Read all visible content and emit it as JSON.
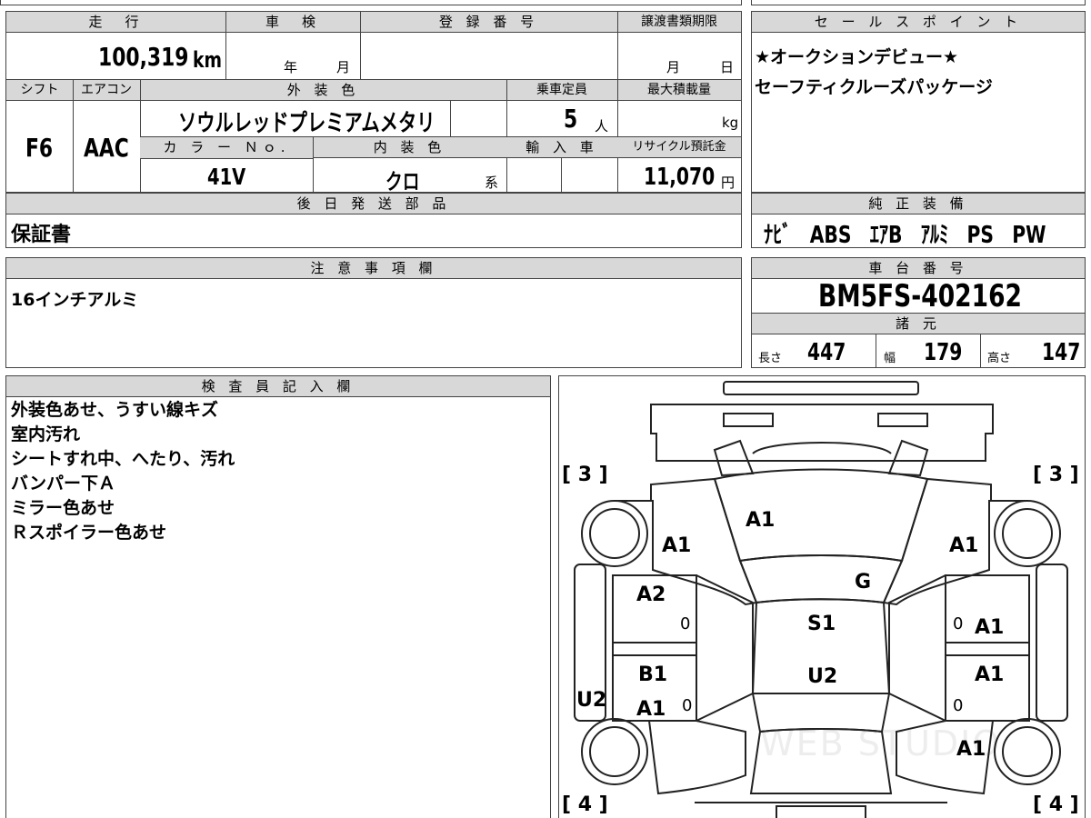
{
  "vehicle": {
    "mileage_header": "走　行",
    "mileage_value": "100,319",
    "mileage_unit": "km",
    "inspection_header": "車　検",
    "inspection_year": "年",
    "inspection_month": "月",
    "registration_header": "登 録 番 号",
    "transfer_header": "譲渡書類期限",
    "transfer_month": "月",
    "transfer_day": "日",
    "shift_header": "シフト",
    "shift_value": "F6",
    "aircon_header": "エアコン",
    "aircon_value": "AAC",
    "exterior_color_header": "外 装 色",
    "exterior_color_value": "ソウルレッドプレミアムメタリ",
    "capacity_header": "乗車定員",
    "capacity_value": "5",
    "capacity_unit": "人",
    "max_load_header": "最大積載量",
    "max_load_unit": "kg",
    "color_no_header": "カ ラ ー Ｎｏ.",
    "color_no_value": "41V",
    "interior_color_header": "内 装 色",
    "interior_color_value": "クロ",
    "interior_suffix": "系",
    "import_header": "輸 入 車",
    "recycle_header": "リサイクル預託金",
    "recycle_value": "11,070",
    "recycle_unit": "円",
    "later_parts_header": "後 日 発 送 部 品",
    "later_parts_value": "保証書",
    "notes_header": "注 意 事 項 欄",
    "notes_value": "16インチアルミ",
    "inspector_header": "検 査 員 記 入 欄",
    "inspector_lines": [
      "外装色あせ、うすい線キズ",
      "室内汚れ",
      "シートすれ中、へたり、汚れ",
      "バンパー下Ａ",
      "ミラー色あせ",
      "Ｒスポイラー色あせ"
    ]
  },
  "sales": {
    "header": "セ ー ル ス ポ イ ン ト",
    "line1": "★オークションデビュー★",
    "line2": "セーフティクルーズパッケージ"
  },
  "equipment": {
    "header": "純 正 装 備",
    "value": "ﾅﾋﾞ　ABS　ｴｱB　ｱﾙﾐ　PS　PW"
  },
  "chassis": {
    "header": "車 台 番 号",
    "value": "BM5FS-402162",
    "specs_header": "諸 元",
    "length_label": "長さ",
    "length_value": "447",
    "width_label": "幅",
    "width_value": "179",
    "height_label": "高さ",
    "height_value": "147"
  },
  "diagram": {
    "tire_fl": "[ 3 ]",
    "tire_fr": "[ 3 ]",
    "tire_rl": "[ 4 ]",
    "tire_rr": "[ 4 ]",
    "marks": {
      "hood": "A1",
      "left_front_fender": "A1",
      "right_front_fender": "A1",
      "windshield": "G",
      "left_front_door": "A2",
      "left_front_zero": "0",
      "roof": "S1",
      "right_front_zero": "0",
      "right_front_door": "A1",
      "left_rear_door_b": "B1",
      "left_rear_door_a": "A1",
      "left_rear_zero": "0",
      "trunk": "U2",
      "right_rear_door": "A1",
      "right_rear_zero": "0",
      "left_side": "U2",
      "right_rear_fender": "A1"
    },
    "watermark": "WEB STUDIO"
  }
}
